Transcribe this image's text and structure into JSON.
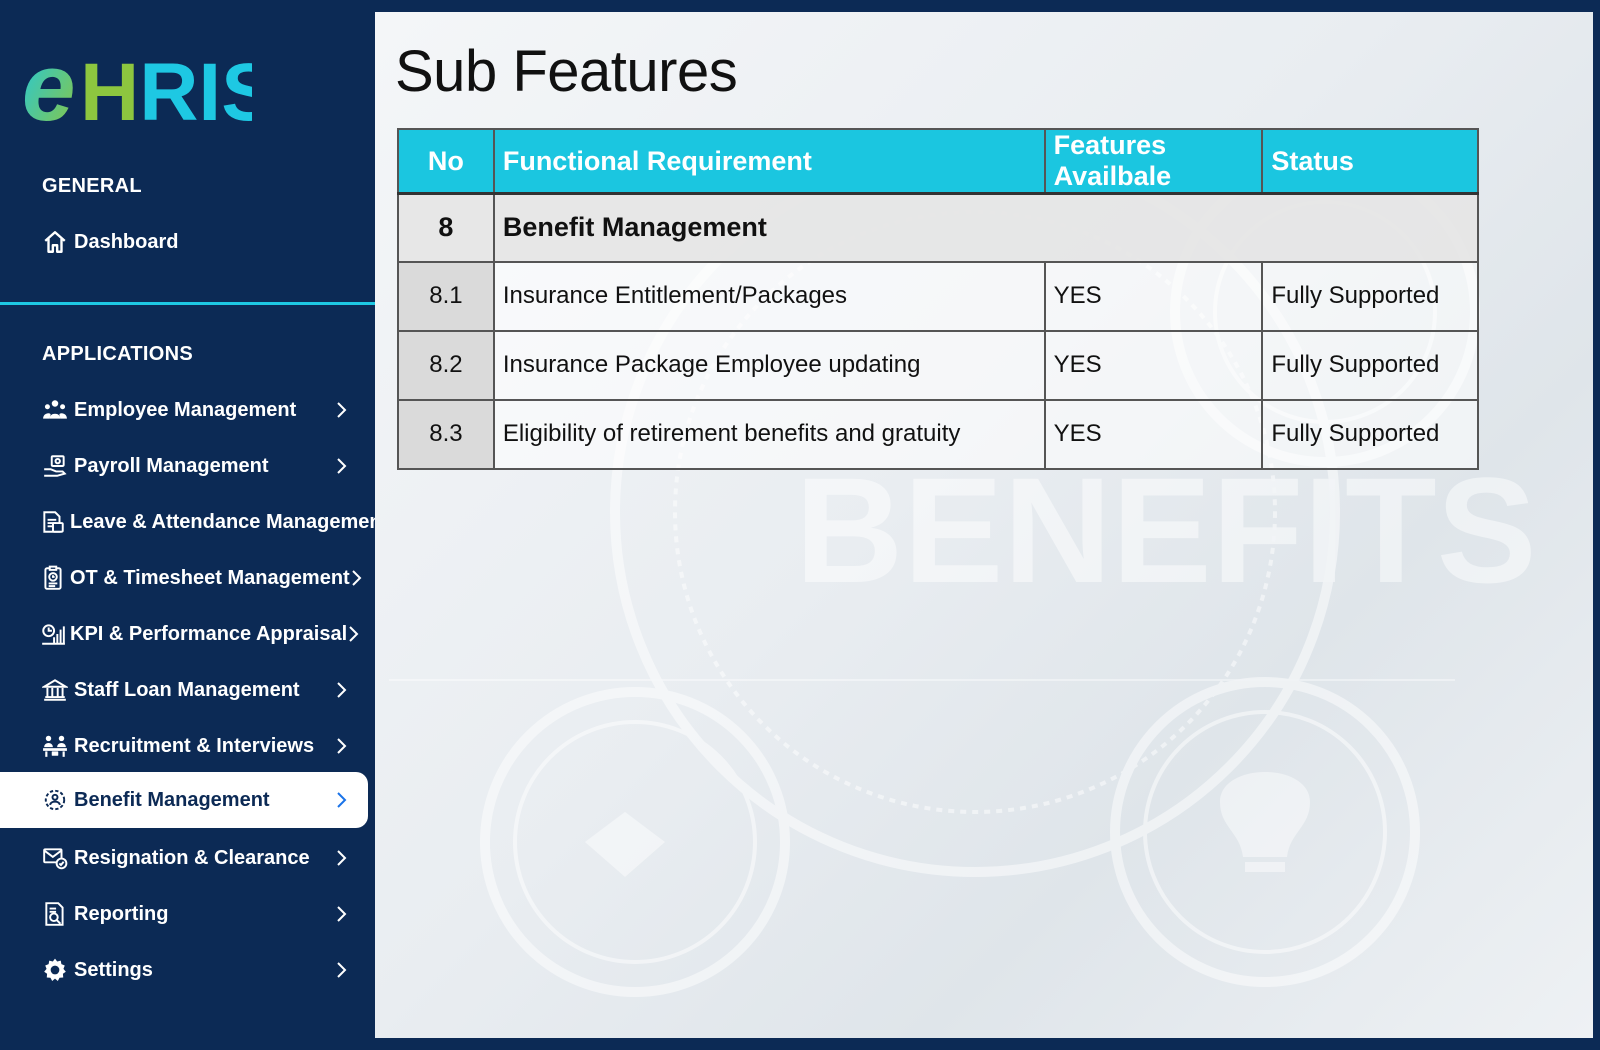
{
  "app": {
    "brand_e": "e",
    "brand_rest": "HRIS"
  },
  "sidebar": {
    "general_label": "GENERAL",
    "dashboard_label": "Dashboard",
    "applications_label": "APPLICATIONS",
    "items": [
      {
        "label": "Employee Management",
        "icon": "users-icon"
      },
      {
        "label": "Payroll Management",
        "icon": "payroll-icon"
      },
      {
        "label": "Leave & Attendance Management",
        "icon": "calendar-doc-icon"
      },
      {
        "label": "OT & Timesheet Management",
        "icon": "timesheet-icon"
      },
      {
        "label": "KPI & Performance Appraisal",
        "icon": "kpi-icon"
      },
      {
        "label": "Staff Loan Management",
        "icon": "bank-icon"
      },
      {
        "label": "Recruitment & Interviews",
        "icon": "interview-icon"
      },
      {
        "label": "Benefit Management",
        "icon": "benefit-icon",
        "active": true
      },
      {
        "label": "Resignation & Clearance",
        "icon": "resignation-icon"
      },
      {
        "label": "Reporting",
        "icon": "report-icon"
      },
      {
        "label": "Settings",
        "icon": "gear-icon"
      }
    ]
  },
  "main": {
    "title": "Sub Features",
    "background_watermark": "BENEFITS",
    "table": {
      "headers": [
        "No",
        "Functional Requirement",
        "Features Availbale",
        "Status"
      ],
      "group": {
        "no": "8",
        "name": "Benefit Management"
      },
      "rows": [
        {
          "no": "8.1",
          "requirement": "Insurance Entitlement/Packages",
          "available": "YES",
          "status": "Fully Supported"
        },
        {
          "no": "8.2",
          "requirement": "Insurance Package Employee updating",
          "available": "YES",
          "status": "Fully Supported"
        },
        {
          "no": "8.3",
          "requirement": "Eligibility of retirement benefits and gratuity",
          "available": "YES",
          "status": "Fully Supported"
        }
      ]
    }
  },
  "colors": {
    "sidebar_bg": "#0c2a55",
    "accent": "#1bc6e0",
    "logo_green": "#8dc63f",
    "active_chevron": "#1a73e8"
  }
}
